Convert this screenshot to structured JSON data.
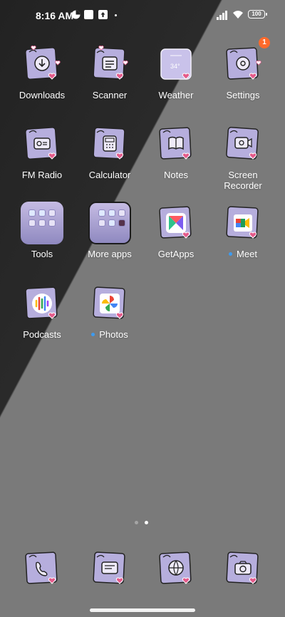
{
  "status": {
    "time": "8:16 AM",
    "battery": "100",
    "icons": [
      "photo-icon",
      "app-icon",
      "upload-icon",
      "more-dot-icon",
      "signal-icon",
      "wifi-icon",
      "battery-icon"
    ]
  },
  "apps": [
    {
      "label": "Downloads",
      "icon": "download-icon"
    },
    {
      "label": "Scanner",
      "icon": "scanner-icon"
    },
    {
      "label": "Weather",
      "icon": "weather-icon",
      "detail": "34°"
    },
    {
      "label": "Settings",
      "icon": "gear-icon",
      "badge": "1"
    },
    {
      "label": "FM Radio",
      "icon": "radio-icon"
    },
    {
      "label": "Calculator",
      "icon": "calculator-icon"
    },
    {
      "label": "Notes",
      "icon": "notes-icon"
    },
    {
      "label": "Screen\nRecorder",
      "icon": "recorder-icon"
    },
    {
      "label": "Tools",
      "icon": "folder-icon"
    },
    {
      "label": "More apps",
      "icon": "folder-icon"
    },
    {
      "label": "GetApps",
      "icon": "getapps-icon"
    },
    {
      "label": "Meet",
      "icon": "meet-icon",
      "new_dot": true
    },
    {
      "label": "Podcasts",
      "icon": "podcasts-icon"
    },
    {
      "label": "Photos",
      "icon": "photos-icon",
      "new_dot": true
    }
  ],
  "dock": [
    {
      "label": "Phone",
      "icon": "phone-icon"
    },
    {
      "label": "Messages",
      "icon": "messages-icon"
    },
    {
      "label": "Browser",
      "icon": "browser-icon"
    },
    {
      "label": "Camera",
      "icon": "camera-icon"
    }
  ],
  "pager": {
    "total": 2,
    "current": 2
  },
  "colors": {
    "accent": "#3d9bf0",
    "badge": "#ff6a2b",
    "icon_bg": "#b7aede"
  }
}
